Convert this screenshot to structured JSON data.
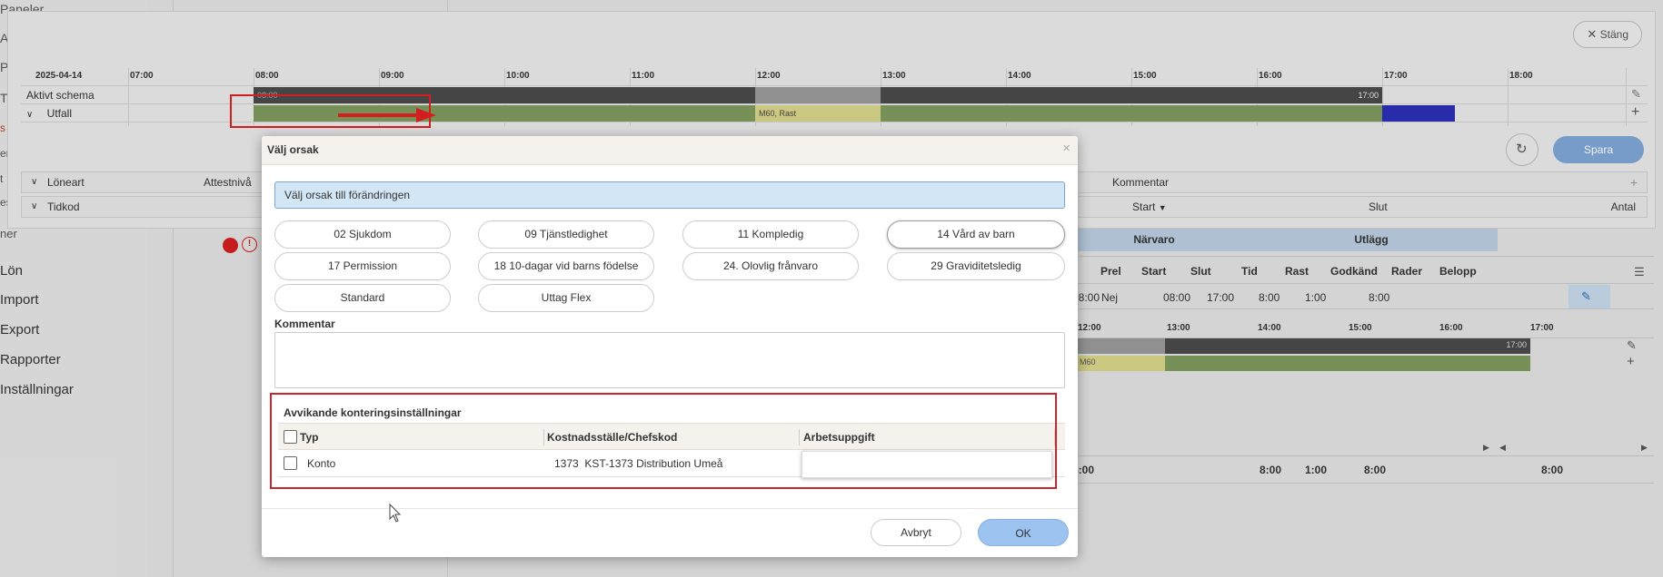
{
  "sidebar": {
    "fragments": [
      "Paneler",
      "A",
      "P",
      "T",
      "s",
      "en",
      "t",
      "es",
      "ner"
    ],
    "items": [
      {
        "label": "Lön"
      },
      {
        "label": "Import"
      },
      {
        "label": "Export"
      },
      {
        "label": "Rapporter"
      },
      {
        "label": "Inställningar"
      }
    ]
  },
  "panel": {
    "close_label": "Stäng",
    "date": "2025-04-14",
    "hours": [
      "07:00",
      "08:00",
      "09:00",
      "10:00",
      "11:00",
      "12:00",
      "13:00",
      "14:00",
      "15:00",
      "16:00",
      "17:00",
      "18:00"
    ],
    "row_active": "Aktivt schema",
    "row_outcome": "Utfall",
    "bar_start_label": "08:00",
    "bar_end_label": "17:00",
    "bar_mid_label": "M60, Rast",
    "save_label": "Spara",
    "loneart_label": "Löneart",
    "attest_label": "Attestnivå",
    "comment_label": "Kommentar",
    "tidkod_label": "Tidkod",
    "start_label": "Start",
    "slut_label": "Slut",
    "antal_label": "Antal"
  },
  "background_grid": {
    "bands": [
      "Närvaro",
      "Utlägg"
    ],
    "headers": [
      "Prel",
      "Start",
      "Slut",
      "Tid",
      "Rast",
      "Godkänd",
      "Rader",
      "Belopp"
    ],
    "row": {
      "first": "08:00",
      "prel": "Nej",
      "start": "08:00",
      "slut": "17:00",
      "tid": "8:00",
      "rast": "1:00",
      "godkand": "8:00"
    },
    "hours": [
      "12:00",
      "13:00",
      "14:00",
      "15:00",
      "16:00",
      "17:00"
    ],
    "bar_end": "17:00",
    "bar_mid": "M60",
    "totals": [
      "8:00",
      "1:00",
      "8:00",
      "8:00"
    ],
    "total_first": "8:00"
  },
  "modal": {
    "title": "Välj orsak",
    "info": "Välj orsak till förändringen",
    "reasons": [
      "02 Sjukdom",
      "09 Tjänstledighet",
      "11 Kompledig",
      "14 Vård av barn",
      "17 Permission",
      "18 10-dagar vid barns födelse",
      "24. Olovlig frånvaro",
      "29 Graviditetsledig",
      "Standard",
      "Uttag Flex"
    ],
    "comment_label": "Kommentar",
    "accounting": {
      "title": "Avvikande konteringsinställningar",
      "col_type": "Typ",
      "col_cost": "Kostnadsställe/Chefskod",
      "col_task": "Arbetsuppgift",
      "row_type": "Konto",
      "row_cost": "1373  KST-1373 Distribution Umeå"
    },
    "cancel_label": "Avbryt",
    "ok_label": "OK"
  },
  "colors": {
    "bar_dark": "#4a4a4a",
    "bar_grey": "#9a9a9a",
    "bar_green": "#7f9a5e",
    "bar_yellow": "#d8d58a",
    "bar_blue": "#2b2fb5",
    "accent": "#7fa6d6",
    "annotation_red": "#e02020"
  }
}
